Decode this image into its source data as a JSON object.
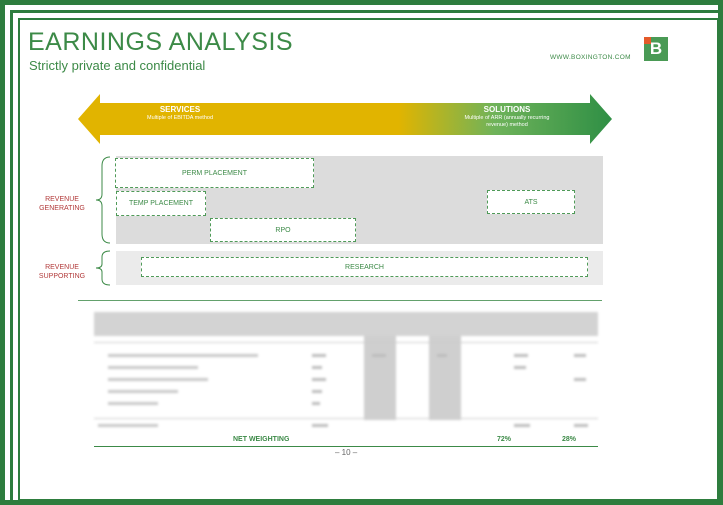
{
  "header": {
    "title": "EARNINGS ANALYSIS",
    "subtitle": "Strictly private and confidential",
    "website": "WWW.BOXINGTON.COM",
    "logo_letter": "B"
  },
  "arrow": {
    "services_title": "SERVICES",
    "services_desc": "Multiple of EBITDA method",
    "solutions_title": "SOLUTIONS",
    "solutions_desc": "Multiple of ARR (annually recurring revenue) method"
  },
  "groups": {
    "revenue_generating": "REVENUE GENERATING",
    "revenue_supporting": "REVENUE SUPPORTING"
  },
  "boxes": {
    "perm": "PERM PLACEMENT",
    "temp": "TEMP PLACEMENT",
    "rpo": "RPO",
    "ats": "ATS",
    "research": "RESEARCH"
  },
  "table": {
    "net_label": "NET WEIGHTING",
    "net_services": "72%",
    "net_solutions": "28%"
  },
  "page_number": "– 10 –",
  "colors": {
    "brand_green": "#3c8a47",
    "services_yellow": "#e1b400",
    "solutions_green": "#3a9a48",
    "revenue_label_red": "#b23a3a"
  }
}
